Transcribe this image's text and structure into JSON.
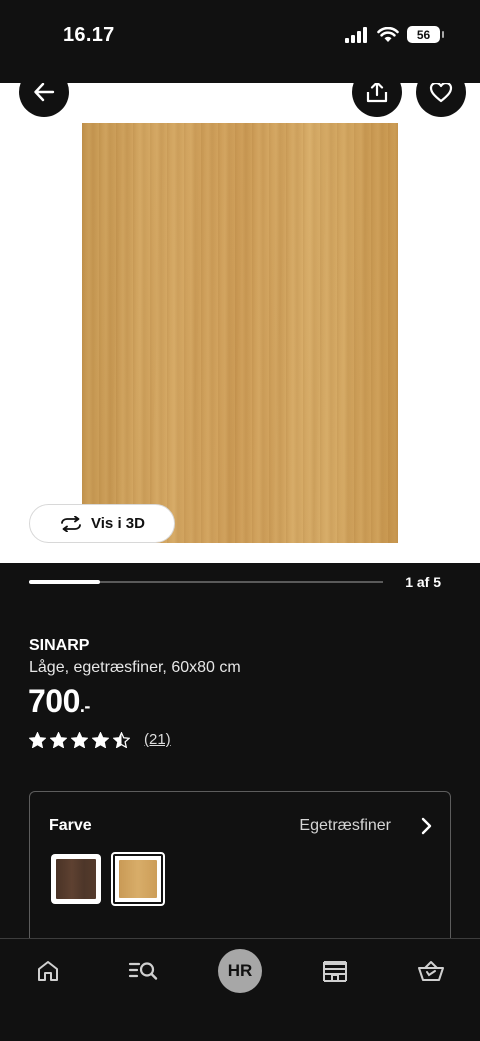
{
  "status_bar": {
    "time": "16.17",
    "battery": "56"
  },
  "product_image": {
    "vis_3d_label": "Vis i 3D"
  },
  "gallery": {
    "page_indicator": "1 af 5",
    "current_page": 1,
    "total_pages": 5
  },
  "product": {
    "name": "SINARP",
    "description": "Låge, egetræsfiner, 60x80 cm",
    "price": "700",
    "price_suffix": ".-",
    "rating_value": 4.5,
    "rating_max": 5,
    "review_count": "(21)"
  },
  "color_selector": {
    "label": "Farve",
    "selected_value": "Egetræsfiner",
    "swatches": [
      "walnut-swatch",
      "oak-veneer-swatch"
    ]
  },
  "bottom_nav": {
    "avatar_initials": "HR",
    "items": [
      "home-icon",
      "search-icon",
      "avatar",
      "store-icon",
      "basket-icon"
    ]
  },
  "colors": {
    "background": "#111111",
    "text": "#ffffff",
    "avatar": "#a7a7a7",
    "wood": "#d2a460"
  }
}
